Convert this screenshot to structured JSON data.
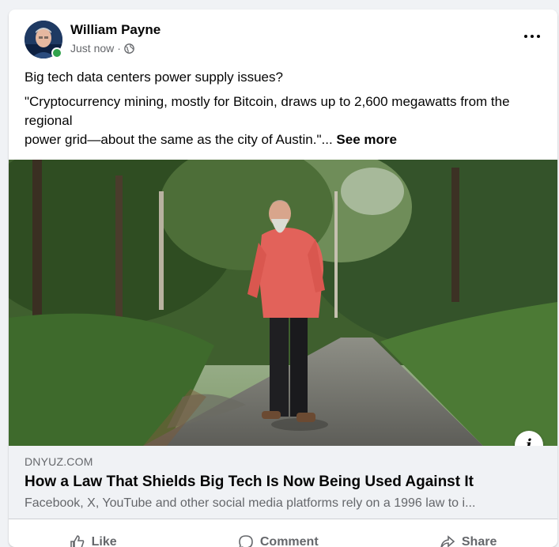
{
  "post": {
    "author": "William Payne",
    "time": "Just now",
    "separator": "·",
    "text_line1": "Big tech data centers power supply issues?",
    "text_line2": "\"Cryptocurrency mining, mostly for Bitcoin, draws up to 2,600 megawatts from the regional",
    "text_line3": "power grid—about the same as the city of Austin.\"...",
    "see_more": "See more"
  },
  "link": {
    "domain": "DNYUZ.COM",
    "title": "How a Law That Shields Big Tech Is Now Being Used Against It",
    "description": "Facebook, X, YouTube and other social media platforms rely on a 1996 law to i..."
  },
  "actions": {
    "like": "Like",
    "comment": "Comment",
    "share": "Share"
  },
  "colors": {
    "online": "#31a24c",
    "background": "#f0f2f5"
  }
}
